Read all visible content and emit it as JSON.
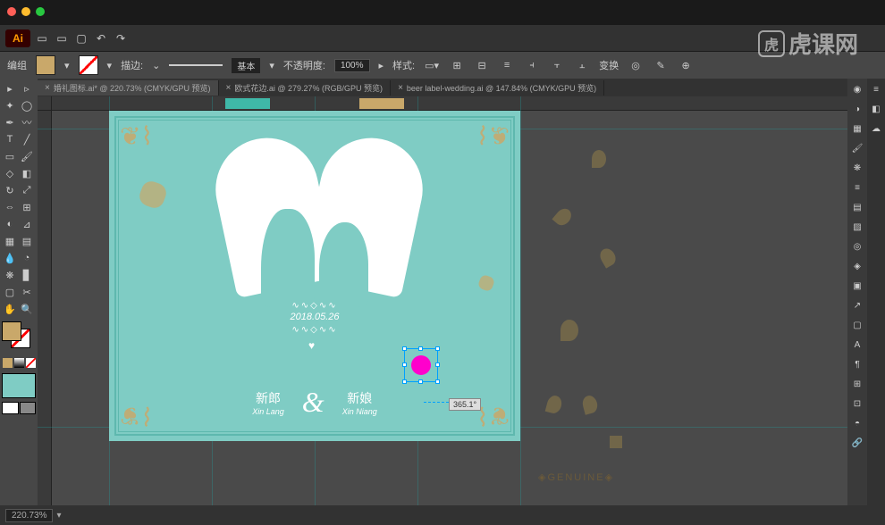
{
  "app": {
    "ai_badge": "Ai"
  },
  "controlbar": {
    "group_label": "编组",
    "stroke_label": "描边:",
    "stroke_style": "基本",
    "opacity_label": "不透明度:",
    "opacity_value": "100%",
    "style_label": "样式:",
    "transform_label": "变换"
  },
  "tabs": [
    {
      "label": "婚礼图标.ai* @ 220.73% (CMYK/GPU 预览)",
      "active": true
    },
    {
      "label": "欧式花边.ai @ 279.27% (RGB/GPU 预览)",
      "active": false
    },
    {
      "label": "beer label-wedding.ai @ 147.84% (CMYK/GPU 预览)",
      "active": false
    }
  ],
  "artwork": {
    "date": "2018.05.26",
    "groom_cn": "新郎",
    "groom_en": "Xin Lang",
    "bride_cn": "新娘",
    "bride_en": "Xin Niang",
    "ampersand": "&",
    "genuine": "◈GENUINE◈"
  },
  "measure": {
    "value": "365.1°"
  },
  "status": {
    "zoom": "220.73%"
  },
  "watermark": {
    "text": "虎课网"
  },
  "colors": {
    "teal": "#7fccc4",
    "gold": "#c9a86a",
    "pink": "#ff00cc"
  }
}
